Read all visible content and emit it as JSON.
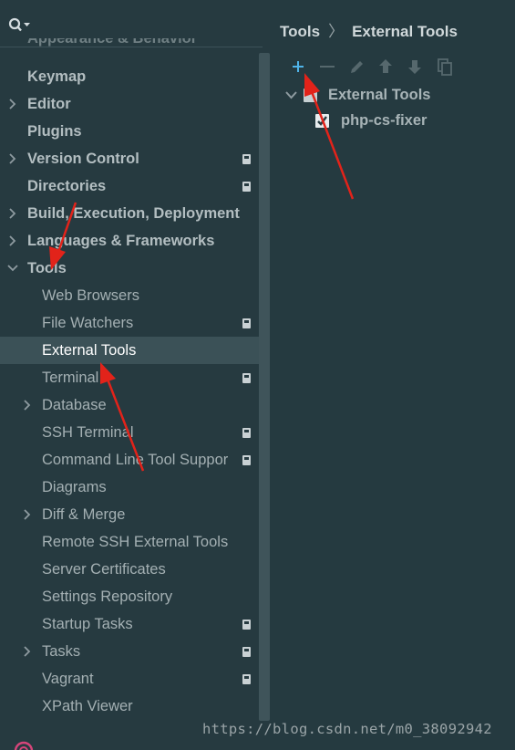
{
  "sidebar": {
    "cut_top_item": "Appearance & Behavior",
    "items": [
      {
        "label": "Keymap"
      },
      {
        "label": "Editor"
      },
      {
        "label": "Plugins"
      },
      {
        "label": "Version Control"
      },
      {
        "label": "Directories"
      },
      {
        "label": "Build, Execution, Deployment"
      },
      {
        "label": "Languages & Frameworks"
      },
      {
        "label": "Tools"
      },
      {
        "label": "Web Browsers"
      },
      {
        "label": "File Watchers"
      },
      {
        "label": "External Tools"
      },
      {
        "label": "Terminal"
      },
      {
        "label": "Database"
      },
      {
        "label": "SSH Terminal"
      },
      {
        "label": "Command Line Tool Suppor"
      },
      {
        "label": "Diagrams"
      },
      {
        "label": "Diff & Merge"
      },
      {
        "label": "Remote SSH External Tools"
      },
      {
        "label": "Server Certificates"
      },
      {
        "label": "Settings Repository"
      },
      {
        "label": "Startup Tasks"
      },
      {
        "label": "Tasks"
      },
      {
        "label": "Vagrant"
      },
      {
        "label": "XPath Viewer"
      }
    ]
  },
  "breadcrumb": {
    "parent": "Tools",
    "separator": "〉",
    "current": "External Tools"
  },
  "toolbar": {
    "add_icon": "plus-icon",
    "remove_icon": "minus-icon",
    "edit_icon": "pencil-icon",
    "up_icon": "arrow-up-icon",
    "down_icon": "arrow-down-icon",
    "copy_icon": "copy-icon"
  },
  "tools_tree": {
    "group_label": "External Tools",
    "tool_label": "php-cs-fixer"
  },
  "watermark": "https://blog.csdn.net/m0_38092942",
  "colors": {
    "background": "#263a40",
    "selected_row": "#3b5157",
    "accent_plus": "#4fb3e8",
    "annotation_arrow": "#e2231a"
  }
}
